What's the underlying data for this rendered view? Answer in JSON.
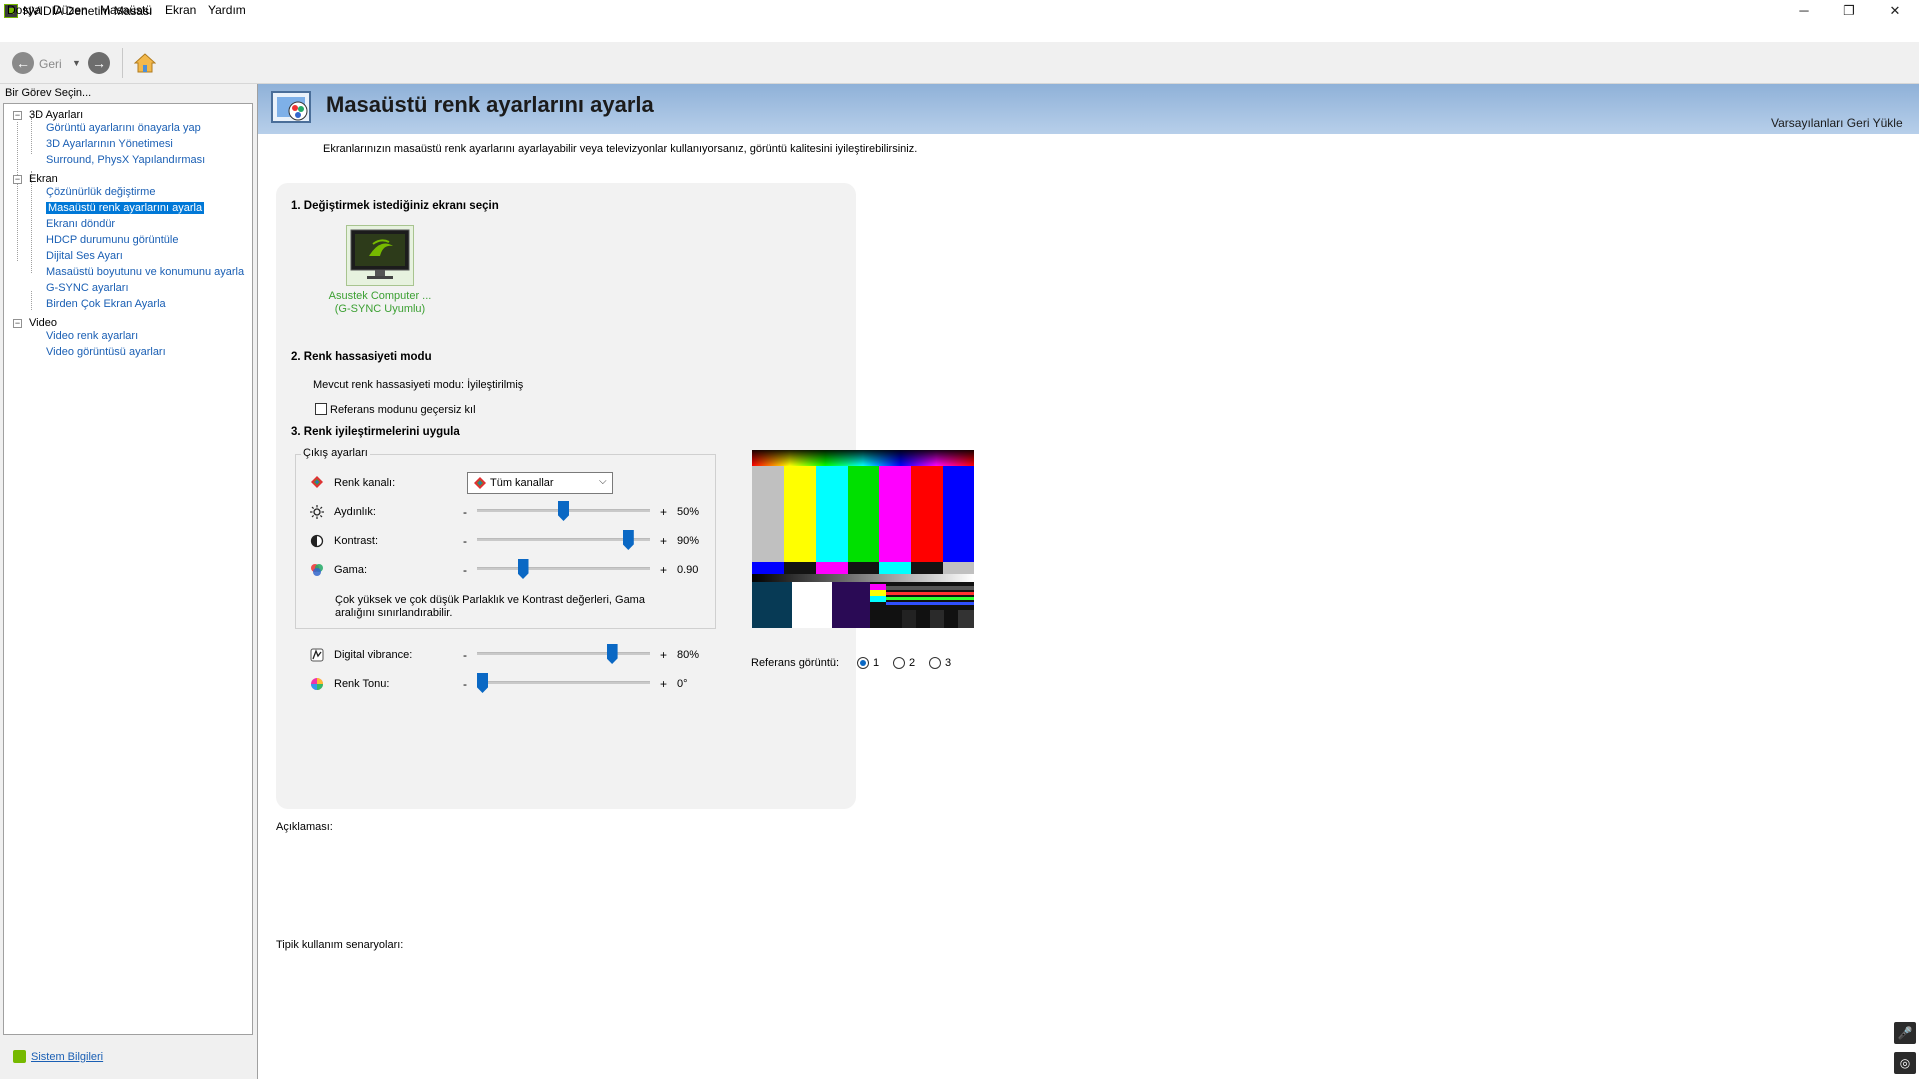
{
  "window": {
    "title": "NVIDIA Denetim Masası"
  },
  "menu": [
    "Dosya",
    "Düzen",
    "Masaüstü",
    "Ekran",
    "Yardım"
  ],
  "toolbar": {
    "back_label": "Geri"
  },
  "sidebar": {
    "task_label": "Bir Görev Seçin...",
    "groups": [
      {
        "label": "3D Ayarları",
        "items": [
          "Görüntü ayarlarını önayarla yap",
          "3D Ayarlarının Yönetimesi",
          "Surround, PhysX Yapılandırması"
        ]
      },
      {
        "label": "Ekran",
        "items": [
          "Çözünürlük değiştirme",
          "Masaüstü renk ayarlarını ayarla",
          "Ekranı döndür",
          "HDCP durumunu görüntüle",
          "Dijital Ses Ayarı",
          "Masaüstü boyutunu ve konumunu ayarla",
          "G-SYNC ayarları",
          "Birden Çok Ekran Ayarla"
        ]
      },
      {
        "label": "Video",
        "items": [
          "Video renk ayarları",
          "Video görüntüsü ayarları"
        ]
      }
    ],
    "system_info": "Sistem Bilgileri"
  },
  "page": {
    "title": "Masaüstü renk ayarlarını ayarla",
    "restore_defaults": "Varsayılanları Geri Yükle",
    "intro": "Ekranlarınızın masaüstü renk ayarlarını ayarlayabilir veya televizyonlar kullanıyorsanız, görüntü kalitesini iyileştirebilirsiniz.",
    "section1": "1. Değiştirmek istediğiniz ekranı seçin",
    "monitor": {
      "name": "Asustek Computer ...",
      "sub": "(G-SYNC Uyumlu)"
    },
    "section2": "2. Renk hassasiyeti modu",
    "current_mode": "Mevcut renk hassasiyeti modu: İyileştirilmiş",
    "override_label": "Referans modunu geçersiz kıl",
    "section3": "3. Renk iyileştirmelerini uygula",
    "output_group": "Çıkış ayarları",
    "channel_label": "Renk kanalı:",
    "channel_value": "Tüm kanallar",
    "sliders": [
      {
        "label": "Aydınlık:",
        "value": "50%",
        "level": 0.5
      },
      {
        "label": "Kontrast:",
        "value": "90%",
        "level": 0.9
      },
      {
        "label": "Gama:",
        "value": "0.90",
        "level": 0.25
      }
    ],
    "warning": "Çok yüksek ve çok düşük Parlaklık ve Kontrast değerleri, Gama aralığını sınırlandırabilir.",
    "sliders2": [
      {
        "label": "Digital vibrance:",
        "value": "80%",
        "level": 0.8
      },
      {
        "label": "Renk Tonu:",
        "value": "0°",
        "level": 0.0
      }
    ],
    "minus": "-",
    "plus": "+",
    "reference_label": "Referans görüntü:",
    "reference_options": [
      "1",
      "2",
      "3"
    ],
    "reference_selected": "1",
    "description_label": "Açıklaması:",
    "usage_label": "Tipik kullanım senaryoları:"
  },
  "colors": {
    "accent": "#0078d7",
    "nvidia_green": "#76b900",
    "link": "#1a5fb4",
    "banner": "#a3c0e2"
  }
}
